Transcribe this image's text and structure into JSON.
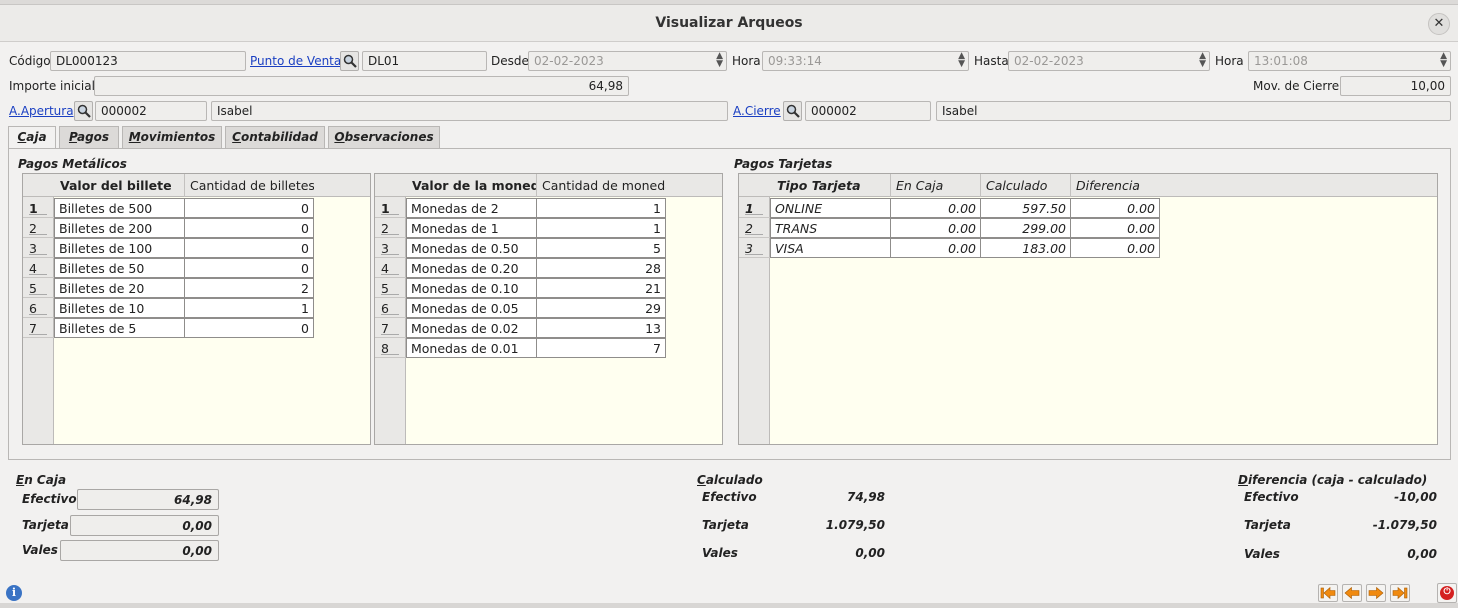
{
  "window": {
    "title": "Visualizar Arqueos",
    "close_symbol": "✕"
  },
  "header": {
    "codigo_label": "Código",
    "codigo_value": "DL000123",
    "punto_venta_label": "Punto de Venta",
    "punto_venta_value": "DL01",
    "desde_label": "Desde",
    "desde_value": "02-02-2023",
    "hora1_label": "Hora",
    "hora1_value": "09:33:14",
    "hasta_label": "Hasta",
    "hasta_value": "02-02-2023",
    "hora2_label": "Hora",
    "hora2_value": "13:01:08",
    "importe_label": "Importe inicial",
    "importe_value": "64,98",
    "mov_cierre_label": "Mov. de Cierre",
    "mov_cierre_value": "10,00",
    "apertura_label": "A.Apertura",
    "apertura_code": "000002",
    "apertura_name": "Isabel",
    "cierre_label": "A.Cierre",
    "cierre_code": "000002",
    "cierre_name": "Isabel"
  },
  "tabs": [
    {
      "first": "C",
      "rest": "aja"
    },
    {
      "first": "P",
      "rest": "agos"
    },
    {
      "first": "M",
      "rest": "ovimientos"
    },
    {
      "first": "C",
      "rest": "ontabilidad"
    },
    {
      "first": "O",
      "rest": "bservaciones"
    }
  ],
  "metal": {
    "title": "Pagos Metálicos",
    "billetes": {
      "headers": [
        "Valor del billete",
        "Cantidad de billetes"
      ],
      "rows": [
        {
          "n": "1",
          "label": "Billetes de 500",
          "qty": "0"
        },
        {
          "n": "2",
          "label": "Billetes de 200",
          "qty": "0"
        },
        {
          "n": "3",
          "label": "Billetes de 100",
          "qty": "0"
        },
        {
          "n": "4",
          "label": "Billetes de 50",
          "qty": "0"
        },
        {
          "n": "5",
          "label": "Billetes de 20",
          "qty": "2"
        },
        {
          "n": "6",
          "label": "Billetes de 10",
          "qty": "1"
        },
        {
          "n": "7",
          "label": "Billetes de 5",
          "qty": "0"
        }
      ]
    },
    "monedas": {
      "headers": [
        "Valor de la moneda",
        "Cantidad de moneda"
      ],
      "rows": [
        {
          "n": "1",
          "label": "Monedas de 2",
          "qty": "1"
        },
        {
          "n": "2",
          "label": "Monedas de 1",
          "qty": "1"
        },
        {
          "n": "3",
          "label": "Monedas de 0.50",
          "qty": "5"
        },
        {
          "n": "4",
          "label": "Monedas de 0.20",
          "qty": "28"
        },
        {
          "n": "5",
          "label": "Monedas de 0.10",
          "qty": "21"
        },
        {
          "n": "6",
          "label": "Monedas de 0.05",
          "qty": "29"
        },
        {
          "n": "7",
          "label": "Monedas de 0.02",
          "qty": "13"
        },
        {
          "n": "8",
          "label": "Monedas de 0.01",
          "qty": "7"
        }
      ]
    }
  },
  "tarjetas": {
    "title": "Pagos Tarjetas",
    "headers": [
      "Tipo Tarjeta",
      "En Caja",
      "Calculado",
      "Diferencia"
    ],
    "rows": [
      {
        "n": "1",
        "tipo": "ONLINE",
        "en_caja": "0.00",
        "calculado": "597.50",
        "diferencia": "0.00"
      },
      {
        "n": "2",
        "tipo": "TRANS",
        "en_caja": "0.00",
        "calculado": "299.00",
        "diferencia": "0.00"
      },
      {
        "n": "3",
        "tipo": "VISA",
        "en_caja": "0.00",
        "calculado": "183.00",
        "diferencia": "0.00"
      }
    ]
  },
  "en_caja": {
    "title_first": "E",
    "title_rest": "n Caja",
    "efectivo_label": "Efectivo",
    "efectivo_value": "64,98",
    "tarjeta_label": "Tarjeta",
    "tarjeta_value": "0,00",
    "vales_label": "Vales",
    "vales_value": "0,00"
  },
  "calculado": {
    "title_first": "C",
    "title_rest": "alculado",
    "efectivo_label": "Efectivo",
    "efectivo_value": "74,98",
    "tarjeta_label": "Tarjeta",
    "tarjeta_value": "1.079,50",
    "vales_label": "Vales",
    "vales_value": "0,00"
  },
  "diferencia": {
    "title_first": "D",
    "title_rest": "iferencia (caja - calculado)",
    "efectivo_label": "Efectivo",
    "efectivo_value": "-10,00",
    "tarjeta_label": "Tarjeta",
    "tarjeta_value": "-1.079,50",
    "vales_label": "Vales",
    "vales_value": "0,00"
  },
  "footer": {
    "info_symbol": "i",
    "power_symbol": "⏻"
  },
  "colors": {
    "accent_link": "#1a3fc2",
    "grid_bg": "#fffff0",
    "info_blue": "#3a73c4",
    "power_red": "#d42020",
    "nav_orange": "#f08a10"
  }
}
